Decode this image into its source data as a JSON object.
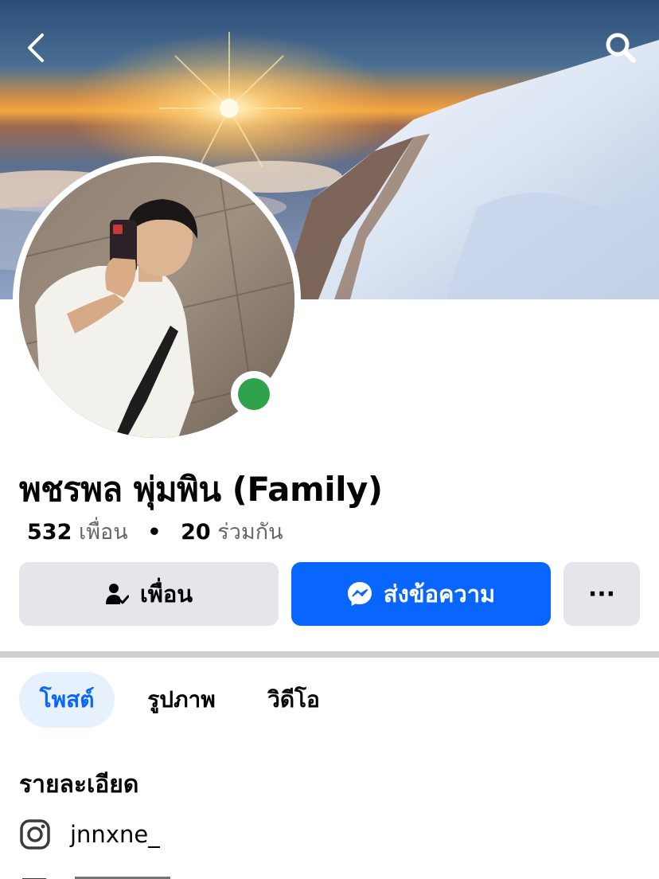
{
  "header": {
    "back_icon": "chevron-left-icon",
    "search_icon": "search-icon"
  },
  "profile": {
    "name": "พชรพล พุ่มพิน (Family)",
    "friends_count": "532",
    "friends_label": "เพื่อน",
    "separator": "•",
    "mutual_count": "20",
    "mutual_label": "ร่วมกัน",
    "online": true,
    "online_color": "#31a24c"
  },
  "actions": {
    "friends_label": "เพื่อน",
    "friends_icon": "person-check-icon",
    "message_label": "ส่งข้อความ",
    "message_icon": "messenger-icon",
    "more_label": "···",
    "accent": "#0866ff"
  },
  "tabs": [
    {
      "label": "โพสต์",
      "active": true
    },
    {
      "label": "รูปภาพ",
      "active": false
    },
    {
      "label": "วิดีโอ",
      "active": false
    }
  ],
  "details": {
    "title": "รายละเอียด",
    "instagram_icon": "instagram-icon",
    "instagram_handle": "jnnxne_"
  }
}
